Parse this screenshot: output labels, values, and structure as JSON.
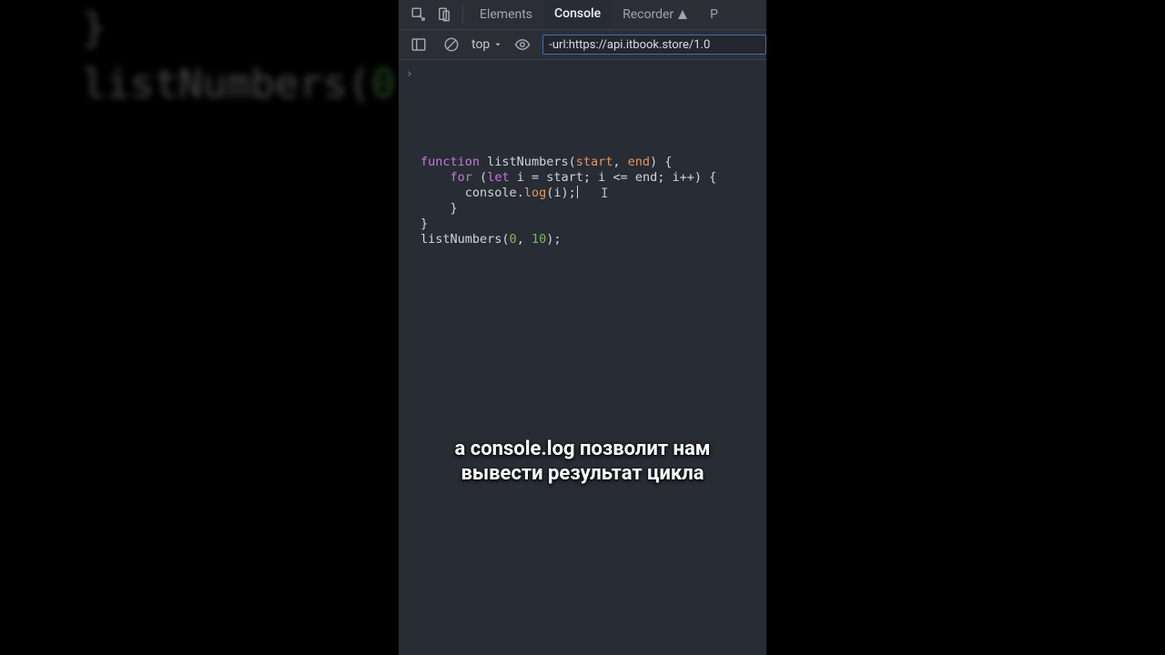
{
  "bg_code": {
    "brace": "}",
    "fn": "listNumbers(",
    "num": "0",
    "tail": ""
  },
  "tabs": {
    "elements": "Elements",
    "console": "Console",
    "recorder": "Recorder",
    "clipped": "P"
  },
  "filter": {
    "context": "top",
    "value": "-url:https://api.itbook.store/1.0"
  },
  "prompt_glyph": "›",
  "code": {
    "kw_function": "function",
    "fn_name": "listNumbers",
    "param_start": "start",
    "param_end": "end",
    "kw_for": "for",
    "kw_let": "let",
    "var_i": "i",
    "eq": " = ",
    "cmp": " <= ",
    "inc": "++",
    "console": "console",
    "log": "log",
    "num_0": "0",
    "num_10": "10"
  },
  "subtitle": {
    "line1": "а console.log позволит нам",
    "line2": "вывести результат цикла"
  }
}
